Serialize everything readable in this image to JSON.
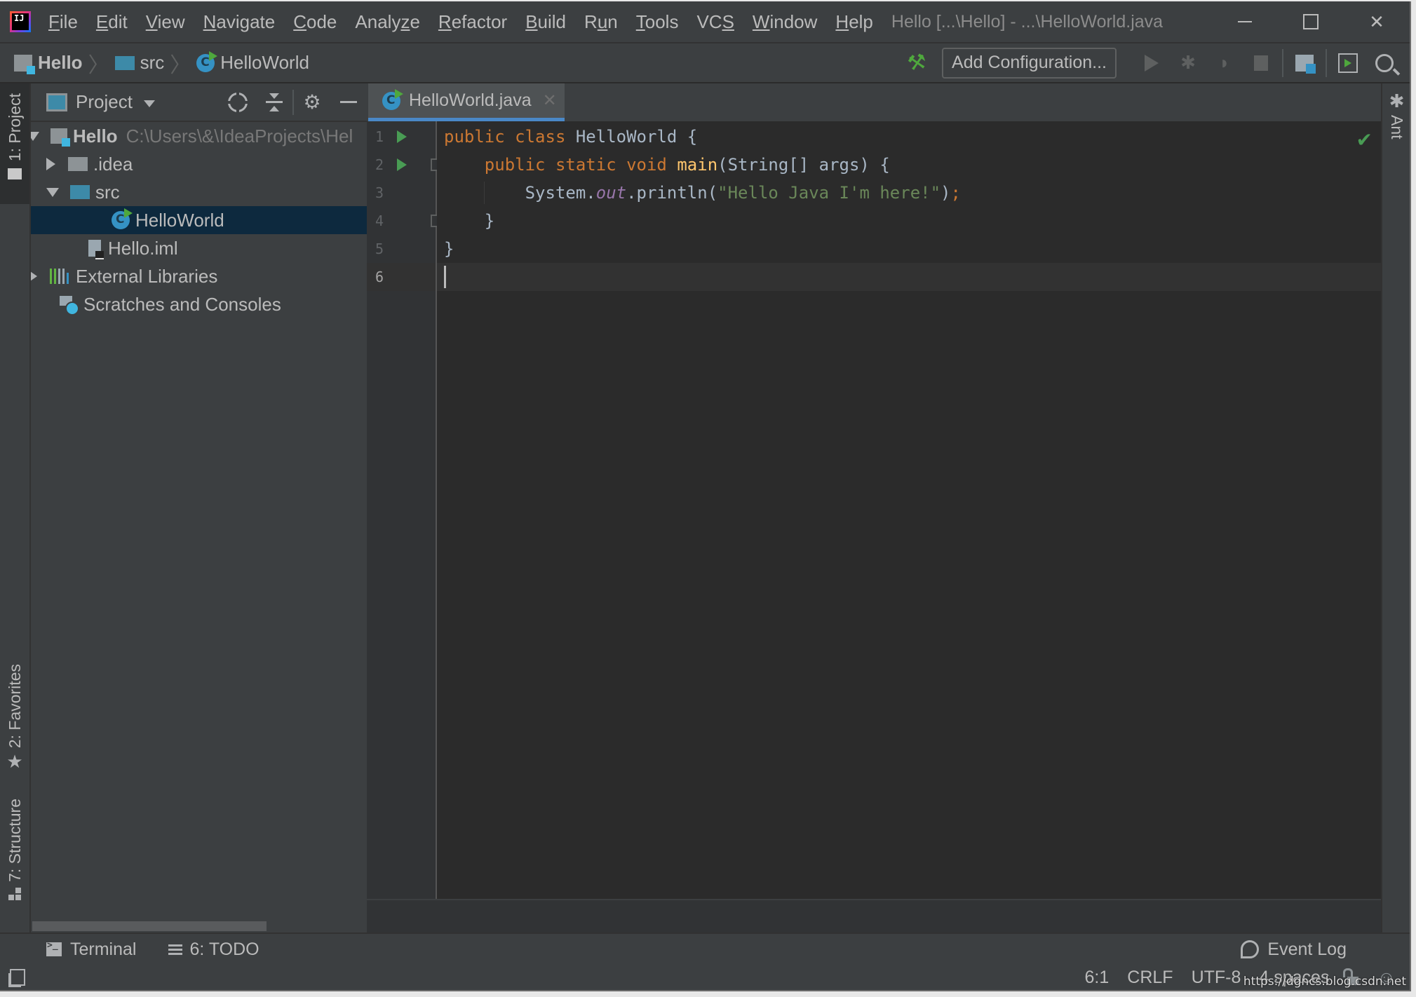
{
  "menu": {
    "items": [
      {
        "label": "File",
        "mnemonic": "F"
      },
      {
        "label": "Edit",
        "mnemonic": "E"
      },
      {
        "label": "View",
        "mnemonic": "V"
      },
      {
        "label": "Navigate",
        "mnemonic": "N"
      },
      {
        "label": "Code",
        "mnemonic": "C"
      },
      {
        "label": "Analyze",
        "mnemonic": "z"
      },
      {
        "label": "Refactor",
        "mnemonic": "R"
      },
      {
        "label": "Build",
        "mnemonic": "B"
      },
      {
        "label": "Run",
        "mnemonic": "u"
      },
      {
        "label": "Tools",
        "mnemonic": "T"
      },
      {
        "label": "VCS",
        "mnemonic": "S"
      },
      {
        "label": "Window",
        "mnemonic": "W"
      },
      {
        "label": "Help",
        "mnemonic": "H"
      }
    ],
    "window_title": "Hello [...\\Hello] - ...\\HelloWorld.java"
  },
  "breadcrumb": {
    "items": [
      "Hello",
      "src",
      "HelloWorld"
    ]
  },
  "toolbar": {
    "add_configuration_label": "Add Configuration...",
    "icons": [
      "build-hammer-icon",
      "run-icon",
      "debug-icon",
      "coverage-icon",
      "stop-icon",
      "project-structure-icon",
      "run-anything-icon",
      "search-everywhere-icon"
    ]
  },
  "left_strip": {
    "project_tab": "1: Project",
    "favorites_tab": "2: Favorites",
    "structure_tab": "7: Structure"
  },
  "right_strip": {
    "ant_tab": "Ant"
  },
  "project_panel": {
    "title": "Project",
    "tree": [
      {
        "label": "Hello",
        "path": "C:\\Users\\&\\IdeaProjects\\Hel",
        "expanded": true,
        "type": "module"
      },
      {
        "label": ".idea",
        "expanded": false,
        "type": "folder"
      },
      {
        "label": "src",
        "expanded": true,
        "type": "source-folder"
      },
      {
        "label": "HelloWorld",
        "type": "class",
        "selected": true
      },
      {
        "label": "Hello.iml",
        "type": "iml-file"
      },
      {
        "label": "External Libraries",
        "expanded": false,
        "type": "libraries"
      },
      {
        "label": "Scratches and Consoles",
        "type": "scratches"
      }
    ]
  },
  "editor": {
    "tab_label": "HelloWorld.java",
    "line_numbers": [
      "1",
      "2",
      "3",
      "4",
      "5",
      "6"
    ],
    "lines": [
      {
        "tokens": [
          [
            "kw",
            "public class "
          ],
          [
            "plain",
            "HelloWorld {"
          ]
        ]
      },
      {
        "tokens": [
          [
            "plain",
            "    "
          ],
          [
            "kw",
            "public static void "
          ],
          [
            "fn",
            "main"
          ],
          [
            "plain",
            "(String[] args) {"
          ]
        ]
      },
      {
        "tokens": [
          [
            "plain",
            "        System."
          ],
          [
            "fld",
            "out"
          ],
          [
            "plain",
            ".println("
          ],
          [
            "str",
            "\"Hello Java I'm here!\""
          ],
          [
            "plain",
            ")"
          ],
          [
            "kw",
            ";"
          ]
        ]
      },
      {
        "tokens": [
          [
            "plain",
            "    }"
          ]
        ]
      },
      {
        "tokens": [
          [
            "plain",
            "}"
          ]
        ]
      },
      {
        "tokens": []
      }
    ],
    "current_line": 6,
    "run_markers_on_lines": [
      1,
      2
    ],
    "inspection_status": "ok"
  },
  "bottom_tools": {
    "terminal_label": "Terminal",
    "todo_label": "6: TODO",
    "event_log_label": "Event Log"
  },
  "status_bar": {
    "caret_position": "6:1",
    "line_separator": "CRLF",
    "encoding": "UTF-8",
    "indent": "4 spaces"
  },
  "watermark": "https://dgncs.blog.csdn.net"
}
